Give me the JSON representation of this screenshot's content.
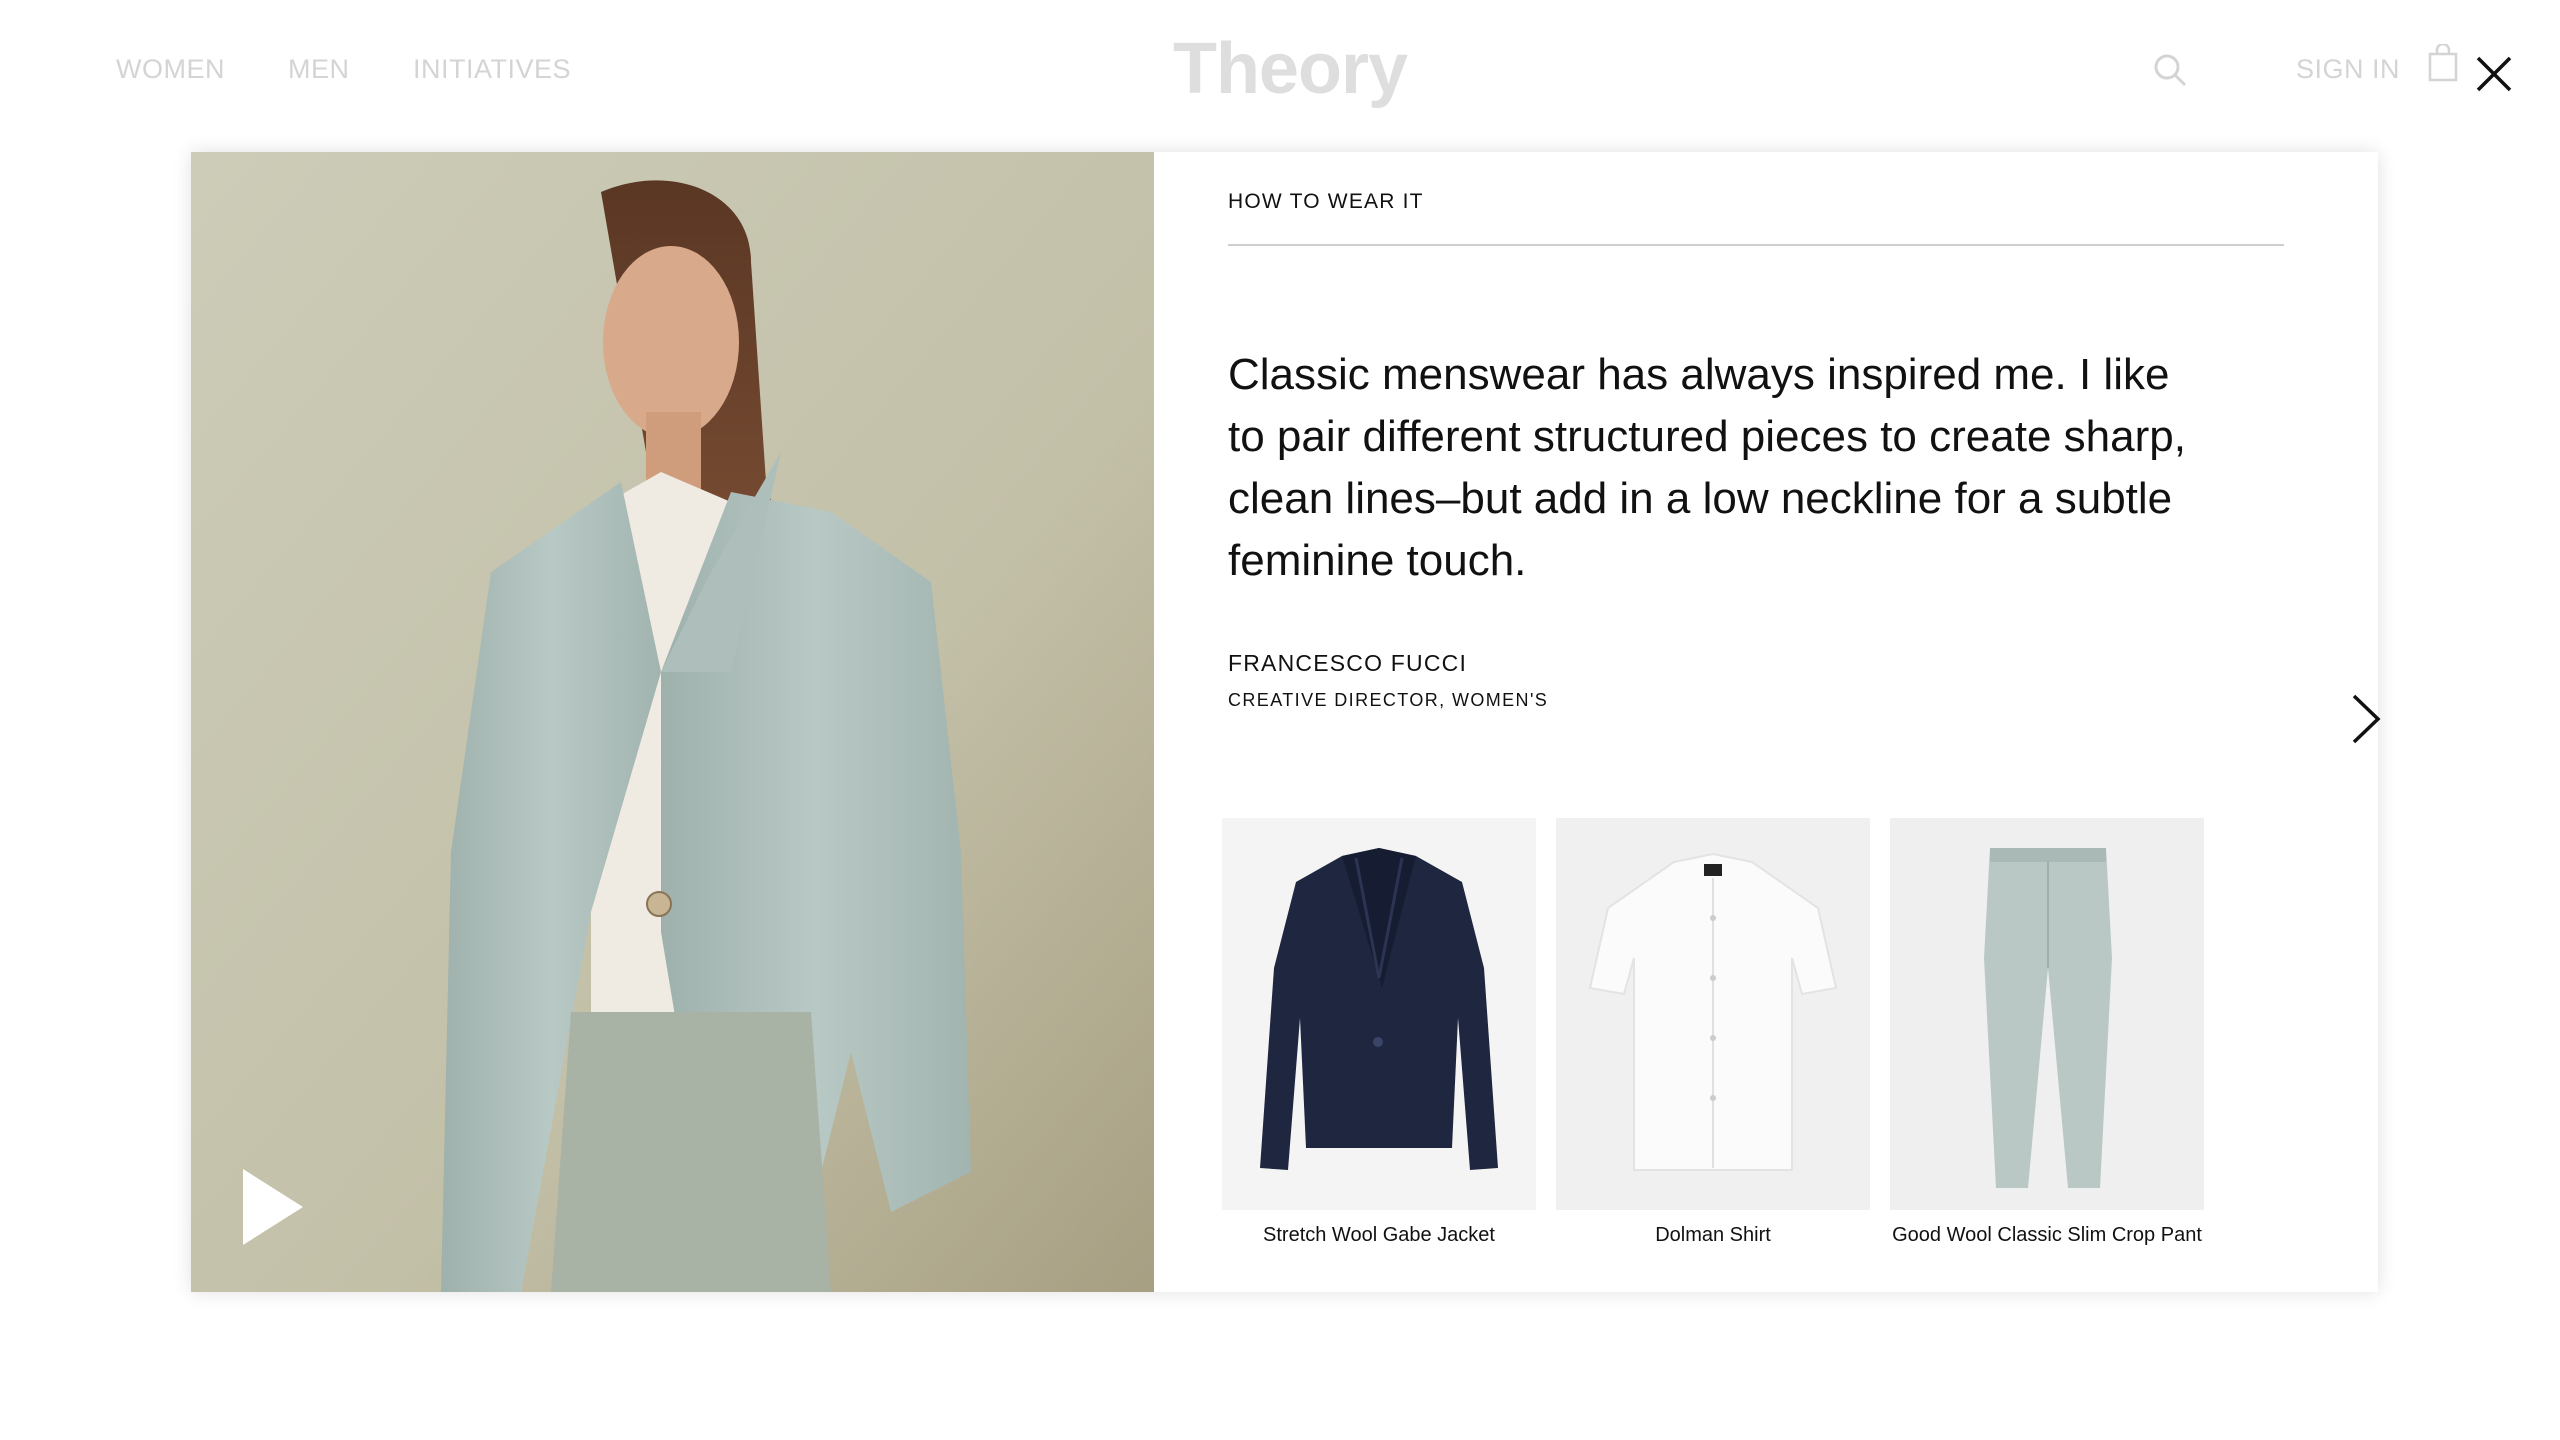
{
  "header": {
    "nav": [
      "WOMEN",
      "MEN",
      "INITIATIVES"
    ],
    "logo": "Theory",
    "sign_in": "SIGN IN",
    "icons": {
      "search": "search-icon",
      "bag": "shopping-bag-icon",
      "close": "close-icon"
    }
  },
  "modal": {
    "eyebrow": "HOW TO WEAR IT",
    "quote": "Classic menswear has always inspired me. I like to pair different structured pieces to create sharp, clean lines–but add in a low neckline for a subtle feminine touch.",
    "author_name": "FRANCESCO FUCCI",
    "author_title": "CREATIVE DIRECTOR, WOMEN'S",
    "media": {
      "play_icon": "play-icon",
      "next_icon": "chevron-right-icon"
    },
    "products": [
      {
        "name": "Stretch Wool Gabe Jacket",
        "image": "navy-blazer"
      },
      {
        "name": "Dolman Shirt",
        "image": "white-shirt"
      },
      {
        "name": "Good Wool Classic Slim Crop Pant",
        "image": "mint-crop-pant"
      }
    ]
  },
  "colors": {
    "background_text": "#d4d4d4",
    "text": "#111111",
    "product_bg": "#f2f1f1",
    "blazer": "#1f2740",
    "mint": "#b9c8c5"
  }
}
